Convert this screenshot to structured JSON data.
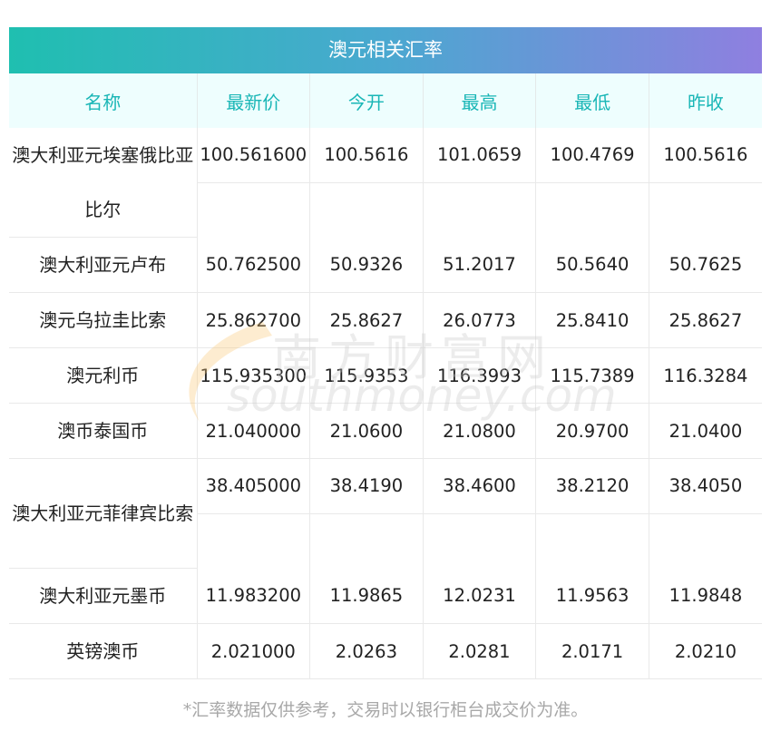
{
  "title": "澳元相关汇率",
  "headers": [
    "名称",
    "最新价",
    "今开",
    "最高",
    "最低",
    "昨收"
  ],
  "rows": [
    {
      "name": "澳大利亚元埃塞俄比亚比尔",
      "values": [
        "100.561600",
        "100.5616",
        "101.0659",
        "100.4769",
        "100.5616"
      ]
    },
    {
      "name": "澳大利亚元卢布",
      "values": [
        "50.762500",
        "50.9326",
        "51.2017",
        "50.5640",
        "50.7625"
      ]
    },
    {
      "name": "澳元乌拉圭比索",
      "values": [
        "25.862700",
        "25.8627",
        "26.0773",
        "25.8410",
        "25.8627"
      ]
    },
    {
      "name": "澳元利币",
      "values": [
        "115.935300",
        "115.9353",
        "116.3993",
        "115.7389",
        "116.3284"
      ]
    },
    {
      "name": "澳币泰国币",
      "values": [
        "21.040000",
        "21.0600",
        "21.0800",
        "20.9700",
        "21.0400"
      ]
    },
    {
      "name": "澳大利亚元菲律宾比索",
      "values": [
        "38.405000",
        "38.4190",
        "38.4600",
        "38.2120",
        "38.4050"
      ]
    },
    {
      "name": "澳大利亚元墨币",
      "values": [
        "11.983200",
        "11.9865",
        "12.0231",
        "11.9563",
        "11.9848"
      ]
    },
    {
      "name": "英镑澳币",
      "values": [
        "2.021000",
        "2.0263",
        "2.0281",
        "2.0171",
        "2.0210"
      ]
    }
  ],
  "footnote": "*汇率数据仅供参考，交易时以银行柜台成交价为准。",
  "watermark": {
    "cn": "南方财富网",
    "en": "southmoney.com"
  },
  "colors": {
    "header_text": "#19b6b6",
    "header_bg": "#eefefe",
    "gradient_start": "#1fbfb0",
    "gradient_end": "#8f7fe0"
  }
}
